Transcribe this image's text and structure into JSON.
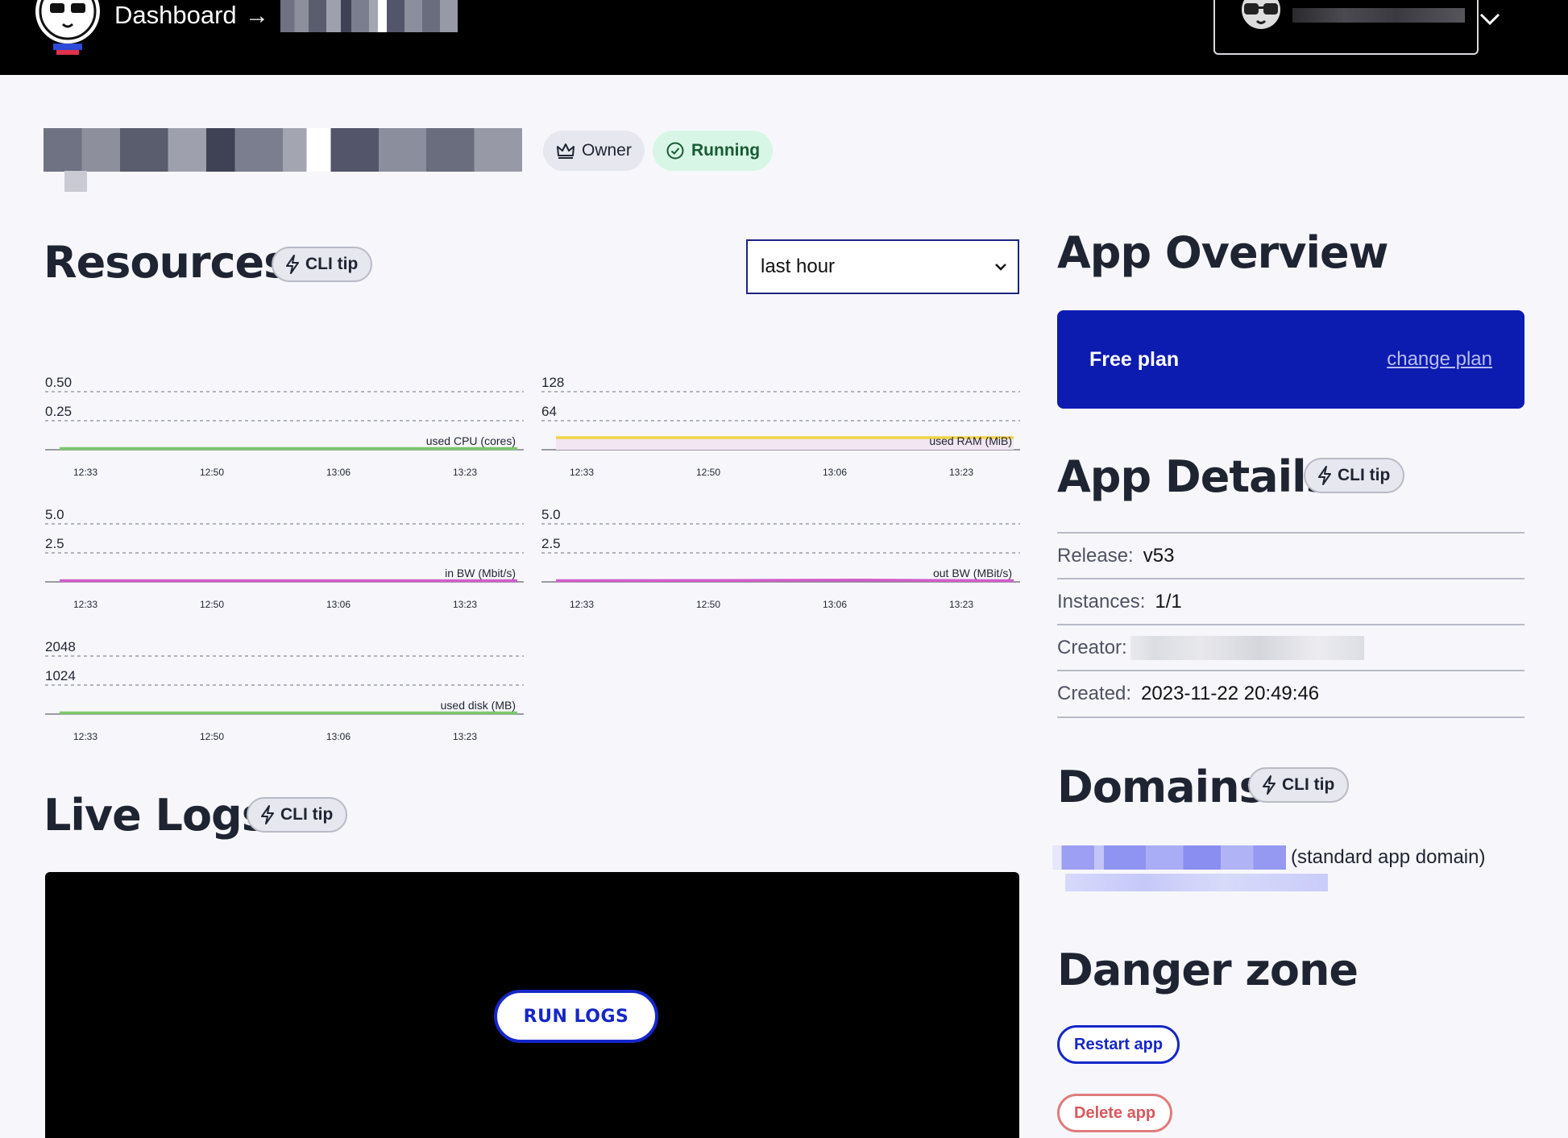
{
  "header": {
    "breadcrumb_dashboard": "Dashboard",
    "breadcrumb_arrow": "→",
    "logo_icon": "mascot-logo-icon",
    "account_icon": "sunglasses-avatar-icon"
  },
  "app": {
    "badge_owner": "Owner",
    "badge_running": "Running"
  },
  "resources": {
    "title": "Resources",
    "cli_tip": "CLI tip",
    "range_select": "last hour"
  },
  "charts": {
    "time_ticks": [
      "12:33",
      "12:50",
      "13:06",
      "13:23"
    ]
  },
  "chart_data": [
    {
      "type": "line",
      "title": "used CPU (cores)",
      "x": [
        "12:33",
        "12:50",
        "13:06",
        "13:23"
      ],
      "yticks": [
        "0.50",
        "0.25"
      ],
      "ylim": [
        0,
        0.75
      ],
      "series": [
        {
          "values": [
            0.0,
            0.0,
            0.0,
            0.0
          ]
        }
      ],
      "color": "#7cc86b"
    },
    {
      "type": "area",
      "title": "used RAM (MiB)",
      "x": [
        "12:33",
        "12:50",
        "13:06",
        "13:23"
      ],
      "yticks": [
        "128",
        "64"
      ],
      "ylim": [
        0,
        192
      ],
      "series": [
        {
          "values": [
            24,
            24,
            24,
            24
          ]
        }
      ],
      "color": "#f0d34a"
    },
    {
      "type": "line",
      "title": "in BW (Mbit/s)",
      "x": [
        "12:33",
        "12:50",
        "13:06",
        "13:23"
      ],
      "yticks": [
        "5.0",
        "2.5"
      ],
      "ylim": [
        0,
        7.5
      ],
      "series": [
        {
          "values": [
            0.0,
            0.0,
            0.0,
            0.0
          ]
        }
      ],
      "color": "#d35cc9"
    },
    {
      "type": "line",
      "title": "out BW (MBit/s)",
      "x": [
        "12:33",
        "12:50",
        "13:06",
        "13:23"
      ],
      "yticks": [
        "5.0",
        "2.5"
      ],
      "ylim": [
        0,
        7.5
      ],
      "series": [
        {
          "values": [
            0.0,
            0.02,
            0.05,
            0.0
          ]
        }
      ],
      "color": "#d35cc9"
    },
    {
      "type": "line",
      "title": "used disk (MB)",
      "x": [
        "12:33",
        "12:50",
        "13:06",
        "13:23"
      ],
      "yticks": [
        "2048",
        "1024"
      ],
      "ylim": [
        0,
        3072
      ],
      "series": [
        {
          "values": [
            0,
            0,
            0,
            0
          ]
        }
      ],
      "color": "#7cc86b"
    }
  ],
  "logs": {
    "title": "Live Logs",
    "cli_tip": "CLI tip",
    "run_button": "RUN LOGS"
  },
  "overview": {
    "title": "App Overview",
    "plan": "Free plan",
    "change_plan": "change plan"
  },
  "details": {
    "title": "App Details",
    "cli_tip": "CLI tip",
    "release_label": "Release:",
    "release_value": "v53",
    "instances_label": "Instances:",
    "instances_value": "1/1",
    "creator_label": "Creator:",
    "created_label": "Created:",
    "created_value": "2023-11-22 20:49:46"
  },
  "domains": {
    "title": "Domains",
    "cli_tip": "CLI tip",
    "standard_tag": "(standard app domain)"
  },
  "danger": {
    "title": "Danger zone",
    "restart": "Restart app",
    "delete": "Delete app"
  }
}
